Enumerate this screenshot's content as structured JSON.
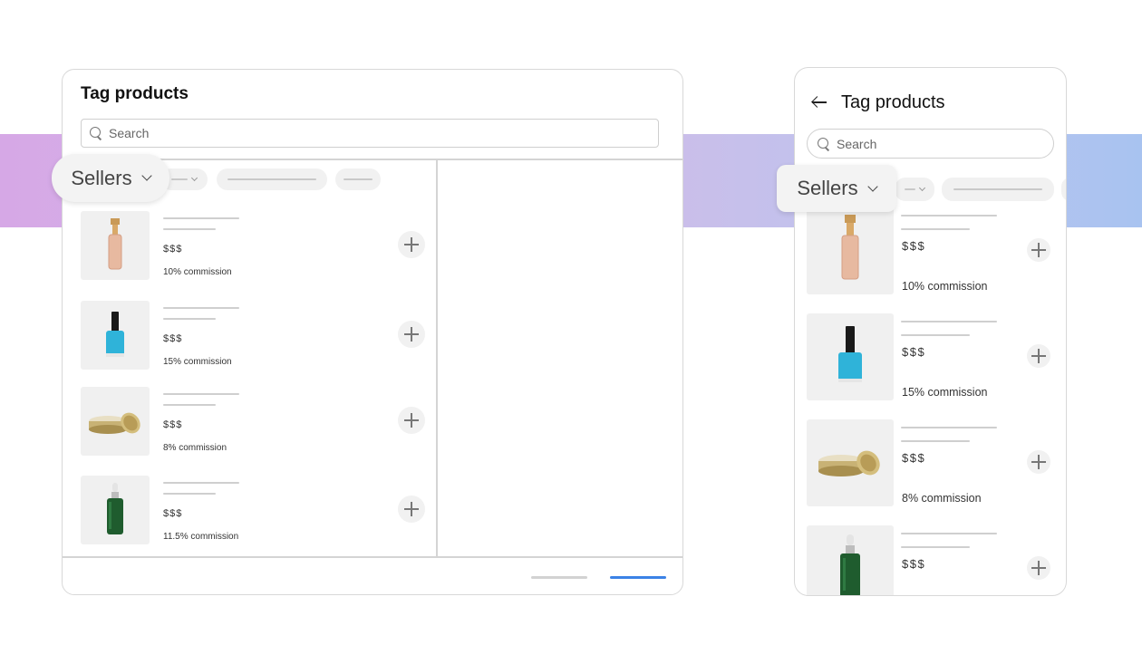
{
  "desktop": {
    "title": "Tag products",
    "search": {
      "placeholder": "Search"
    },
    "sellers_label": "Sellers",
    "products": [
      {
        "price": "$$$",
        "commission": "10% commission",
        "icon": "foundation-bottle-icon"
      },
      {
        "price": "$$$",
        "commission": "15% commission",
        "icon": "nail-polish-icon"
      },
      {
        "price": "$$$",
        "commission": "8% commission",
        "icon": "cream-jar-icon"
      },
      {
        "price": "$$$",
        "commission": "11.5% commission",
        "icon": "serum-dropper-bottle-icon"
      }
    ]
  },
  "mobile": {
    "title": "Tag products",
    "search": {
      "placeholder": "Search"
    },
    "sellers_label": "Sellers",
    "products": [
      {
        "price": "$$$",
        "commission": "10% commission",
        "icon": "foundation-bottle-icon"
      },
      {
        "price": "$$$",
        "commission": "15% commission",
        "icon": "nail-polish-icon"
      },
      {
        "price": "$$$",
        "commission": "8% commission",
        "icon": "cream-jar-icon"
      },
      {
        "price": "$$$",
        "icon": "serum-dropper-bottle-icon"
      }
    ]
  },
  "colors": {
    "accent": "#3b82e6",
    "band_start": "#d6a8e6",
    "band_end": "#a8c3f0"
  }
}
